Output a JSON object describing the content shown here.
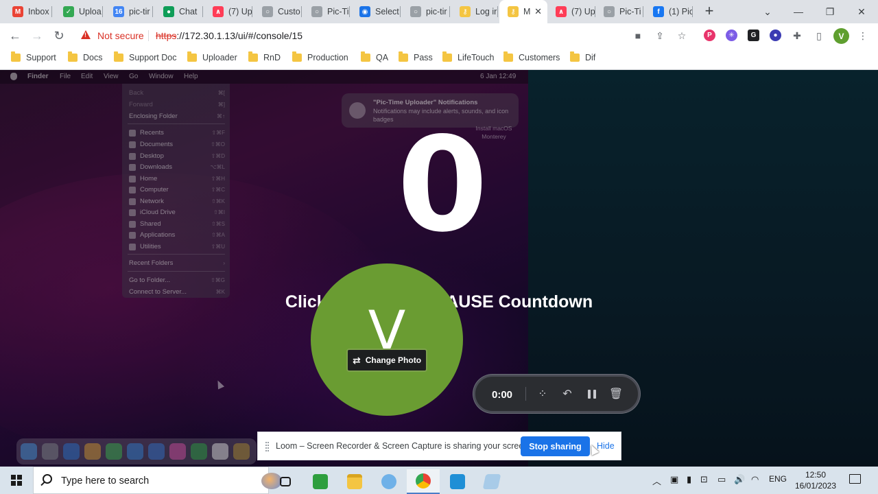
{
  "browser": {
    "tabs": [
      {
        "label": "Inbox",
        "favicon": "gmail-icon",
        "color": "#ea4335",
        "glyph": "M"
      },
      {
        "label": "Uploa",
        "favicon": "check-icon",
        "color": "#34a853",
        "glyph": "✓"
      },
      {
        "label": "pic-tir",
        "favicon": "calendar-icon",
        "color": "#4285f4",
        "glyph": "16"
      },
      {
        "label": "Chat",
        "favicon": "chat-icon",
        "color": "#0f9d58",
        "glyph": "●"
      },
      {
        "label": "(7) Up",
        "favicon": "monday-icon",
        "color": "#ff3d57",
        "glyph": "∧"
      },
      {
        "label": "Custo",
        "favicon": "pic-time-icon",
        "color": "#9aa0a6",
        "glyph": "○"
      },
      {
        "label": "Pic-Ti",
        "favicon": "pic-time-icon",
        "color": "#9aa0a6",
        "glyph": "○"
      },
      {
        "label": "Select",
        "favicon": "select-icon",
        "color": "#1a73e8",
        "glyph": "◉"
      },
      {
        "label": "pic-tir",
        "favicon": "pic-time-icon",
        "color": "#9aa0a6",
        "glyph": "○"
      },
      {
        "label": "Log ir",
        "favicon": "key-icon",
        "color": "#f4c542",
        "glyph": "⚷"
      },
      {
        "label": "M",
        "favicon": "key-icon",
        "color": "#f4c542",
        "glyph": "⚷",
        "active": true
      },
      {
        "label": "(7) Up",
        "favicon": "monday-icon",
        "color": "#ff3d57",
        "glyph": "∧"
      },
      {
        "label": "Pic-Ti",
        "favicon": "pic-time-icon",
        "color": "#9aa0a6",
        "glyph": "○"
      },
      {
        "label": "(1) Pic",
        "favicon": "facebook-icon",
        "color": "#1877f2",
        "glyph": "f"
      }
    ],
    "security_label": "Not secure",
    "url_scheme": "https",
    "url_rest": "://172.30.1.13/ui/#/console/15",
    "profile_initial": "V",
    "bookmarks": [
      "Support",
      "Docs",
      "Support Doc",
      "Uploader",
      "RnD",
      "Production",
      "QA",
      "Pass",
      "LifeTouch",
      "Customers",
      "Dif"
    ]
  },
  "mac": {
    "menubar": [
      "Finder",
      "File",
      "Edit",
      "View",
      "Go",
      "Window",
      "Help"
    ],
    "menubar_time": "6 Jan  12:49",
    "go_menu": [
      {
        "label": "Back",
        "shortcut": "⌘[",
        "disabled": true
      },
      {
        "label": "Forward",
        "shortcut": "⌘]",
        "disabled": true
      },
      {
        "label": "Enclosing Folder",
        "shortcut": "⌘↑"
      },
      {
        "label": "Recents",
        "shortcut": "⇧⌘F",
        "icon": "clock-icon"
      },
      {
        "label": "Documents",
        "shortcut": "⇧⌘O",
        "icon": "document-icon"
      },
      {
        "label": "Desktop",
        "shortcut": "⇧⌘D",
        "icon": "desktop-icon"
      },
      {
        "label": "Downloads",
        "shortcut": "⌥⌘L",
        "icon": "download-icon"
      },
      {
        "label": "Home",
        "shortcut": "⇧⌘H",
        "icon": "home-icon"
      },
      {
        "label": "Computer",
        "shortcut": "⇧⌘C",
        "icon": "computer-icon"
      },
      {
        "label": "Network",
        "shortcut": "⇧⌘K",
        "icon": "network-icon"
      },
      {
        "label": "iCloud Drive",
        "shortcut": "⇧⌘I",
        "icon": "cloud-icon"
      },
      {
        "label": "Shared",
        "shortcut": "⇧⌘S",
        "icon": "shared-icon"
      },
      {
        "label": "Applications",
        "shortcut": "⇧⌘A",
        "icon": "applications-icon"
      },
      {
        "label": "Utilities",
        "shortcut": "⇧⌘U",
        "icon": "utilities-icon"
      },
      {
        "label": "Recent Folders",
        "shortcut": "›"
      },
      {
        "label": "Go to Folder...",
        "shortcut": "⇧⌘G"
      },
      {
        "label": "Connect to Server...",
        "shortcut": "⌘K"
      }
    ],
    "notification": {
      "title": "\"Pic-Time Uploader\" Notifications",
      "body": "Notifications may include alerts, sounds, and icon badges"
    },
    "install_label": "Install macOS Monterey"
  },
  "loom": {
    "countdown": "0",
    "hint": "Click anywhere to PAUSE Countdown",
    "avatar_initial": "V",
    "change_photo": "Change Photo",
    "timer": "0:00",
    "share_message": "Loom – Screen Recorder & Screen Capture is sharing your screen.",
    "stop_sharing": "Stop sharing",
    "hide": "Hide"
  },
  "taskbar": {
    "search_placeholder": "Type here to search",
    "language": "ENG",
    "time": "12:50",
    "date": "16/01/2023"
  },
  "colors": {
    "accent": "#1a73e8",
    "avatar_bg": "#6a9c32",
    "warning": "#d93025"
  }
}
